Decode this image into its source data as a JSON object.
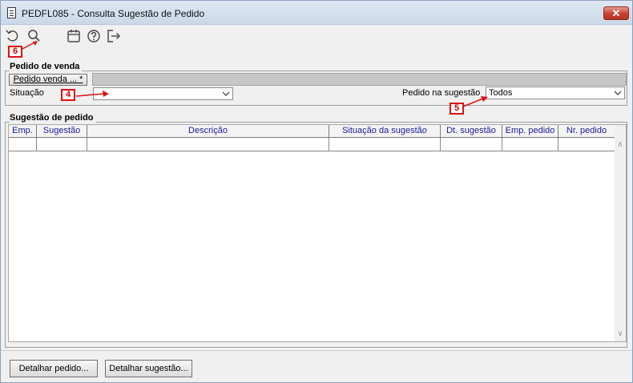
{
  "window": {
    "title": "PEDFL085 - Consulta Sugestão de Pedido",
    "close_glyph": "✕"
  },
  "toolbar": {
    "icons": [
      "undo-icon",
      "search-icon",
      "calendar-icon",
      "help-icon",
      "exit-icon"
    ]
  },
  "annotations": {
    "badge_6": "6",
    "badge_4": "4",
    "badge_5": "5",
    "color": "#e01010"
  },
  "pedido_venda": {
    "group_title": "Pedido de venda",
    "button_label": "Pedido venda ... *",
    "situacao_label": "Situação",
    "situacao_value": "",
    "pedido_sugestao_label": "Pedido na sugestão",
    "pedido_sugestao_value": "Todos"
  },
  "sugestao": {
    "group_title": "Sugestão de pedido",
    "columns": [
      "Emp.",
      "Sugestão",
      "Descrição",
      "Situação da sugestão",
      "Dt. sugestão",
      "Emp. pedido",
      "Nr. pedido"
    ]
  },
  "footer": {
    "detalhar_pedido": "Detalhar pedido...",
    "detalhar_sugestao": "Detalhar sugestão..."
  }
}
